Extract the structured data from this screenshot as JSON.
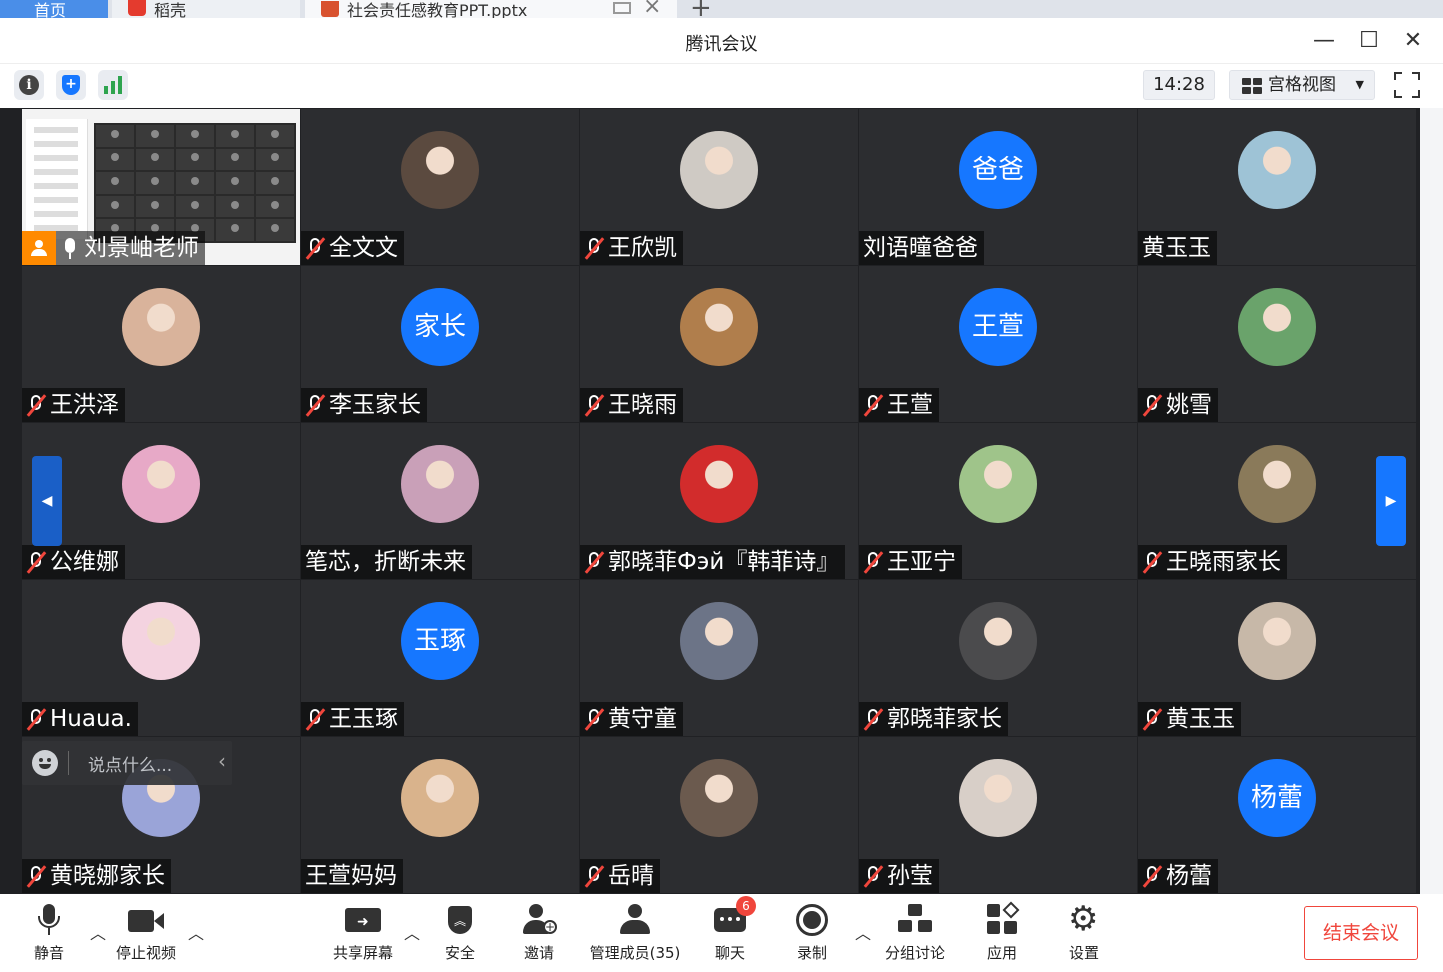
{
  "os_tabs": {
    "home": "首页",
    "daoke": "稻壳",
    "ppt": "社会责任感教育PPT.pptx",
    "new_tab": "+"
  },
  "window": {
    "title": "腾讯会议",
    "minimize": "—",
    "maximize": "☐",
    "close": "✕"
  },
  "toolbar": {
    "info": "i",
    "security": "+",
    "time": "14:28",
    "view_mode": "宫格视图",
    "view_caret": "▼"
  },
  "participants": [
    {
      "name": "刘景岫老师",
      "type": "screen",
      "host": true,
      "muted": false
    },
    {
      "name": "全文文",
      "type": "photo",
      "muted": true,
      "color": "#5b4a3f"
    },
    {
      "name": "王欣凯",
      "type": "photo",
      "muted": true,
      "color": "#cfcac4"
    },
    {
      "name": "刘语曈爸爸",
      "type": "text",
      "avatar_text": "爸爸",
      "muted": false
    },
    {
      "name": "黄玉玉",
      "type": "photo",
      "muted": false,
      "color": "#9ec3d6"
    },
    {
      "name": "王洪泽",
      "type": "photo",
      "muted": true,
      "color": "#d9b39b"
    },
    {
      "name": "李玉家长",
      "type": "text",
      "avatar_text": "家长",
      "muted": true
    },
    {
      "name": "王晓雨",
      "type": "photo",
      "muted": true,
      "color": "#b07e4c"
    },
    {
      "name": "王萱",
      "type": "text",
      "avatar_text": "王萱",
      "muted": true
    },
    {
      "name": "姚雪",
      "type": "photo",
      "muted": true,
      "color": "#6aa36b"
    },
    {
      "name": "公维娜",
      "type": "photo",
      "muted": true,
      "color": "#e7a9c7"
    },
    {
      "name": "笔芯，折断未来",
      "type": "photo",
      "muted": false,
      "color": "#c9a0b8"
    },
    {
      "name": "郭晓菲Фэй『韩菲诗』",
      "type": "photo",
      "muted": true,
      "color": "#d22c2c"
    },
    {
      "name": "王亚宁",
      "type": "photo",
      "muted": true,
      "color": "#9fc48a"
    },
    {
      "name": "王晓雨家长",
      "type": "photo",
      "muted": true,
      "color": "#8a7a5a"
    },
    {
      "name": "Huaua.",
      "type": "photo",
      "muted": true,
      "color": "#f4d3e0"
    },
    {
      "name": "王玉琢",
      "type": "text",
      "avatar_text": "玉琢",
      "muted": true
    },
    {
      "name": "黄守童",
      "type": "photo",
      "muted": true,
      "color": "#6c7487"
    },
    {
      "name": "郭晓菲家长",
      "type": "photo",
      "muted": true,
      "color": "#4b4b4d"
    },
    {
      "name": "黄玉玉",
      "type": "photo",
      "muted": true,
      "color": "#c7b8a8"
    },
    {
      "name": "黄晓娜家长",
      "type": "photo",
      "muted": true,
      "color": "#9aa4d8"
    },
    {
      "name": "王萱妈妈",
      "type": "photo",
      "muted": false,
      "color": "#d9b38c"
    },
    {
      "name": "岳晴",
      "type": "photo",
      "muted": true,
      "color": "#6b5a4e"
    },
    {
      "name": "孙莹",
      "type": "photo",
      "muted": true,
      "color": "#d8cfc8"
    },
    {
      "name": "杨蕾",
      "type": "text",
      "avatar_text": "杨蕾",
      "muted": true
    }
  ],
  "chat_input": {
    "placeholder": "说点什么...",
    "collapse": "‹"
  },
  "pager": {
    "prev": "◀",
    "next": "▶"
  },
  "controls": {
    "mute": "静音",
    "stop_video": "停止视频",
    "share_screen": "共享屏幕",
    "security": "安全",
    "invite": "邀请",
    "manage_members": "管理成员(35)",
    "chat": "聊天",
    "chat_badge": "6",
    "record": "录制",
    "breakout": "分组讨论",
    "apps": "应用",
    "settings": "设置",
    "end_meeting": "结束会议"
  },
  "colors": {
    "accent": "#1677ff",
    "danger": "#f0463c",
    "host_badge": "#ff8a00",
    "tile_bg": "#2c2d30"
  }
}
